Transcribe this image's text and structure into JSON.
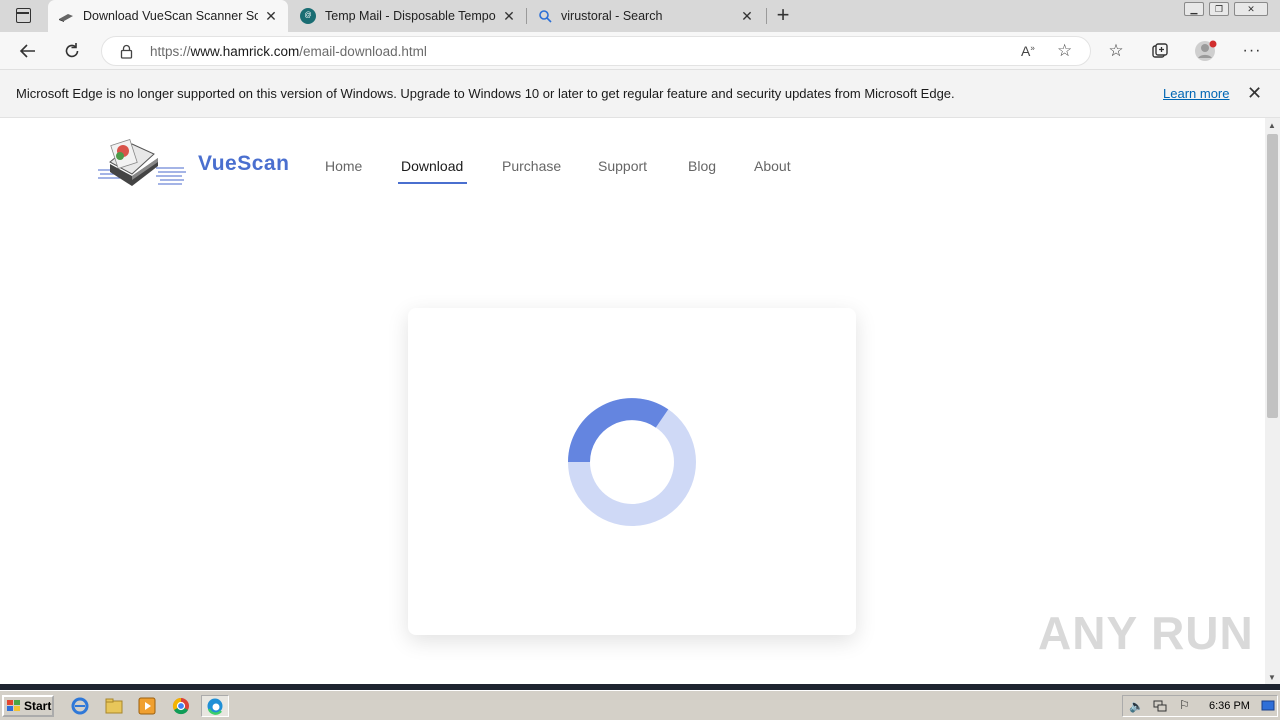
{
  "tabs": [
    {
      "title": "Download VueScan Scanner Software",
      "icon": "scanner-icon"
    },
    {
      "title": "Temp Mail - Disposable Temporary Email",
      "icon": "tempmail-icon"
    },
    {
      "title": "virustoral - Search",
      "icon": "search-icon"
    }
  ],
  "new_tab_label": "+",
  "address": {
    "prefix": "https://",
    "host": "www.hamrick.com",
    "path": "/email-download.html"
  },
  "infobar": {
    "message": "Microsoft Edge is no longer supported on this version of Windows. Upgrade to Windows 10 or later to get regular feature and security updates from Microsoft Edge.",
    "link": "Learn more"
  },
  "site": {
    "brand": "VueScan",
    "nav": [
      "Home",
      "Download",
      "Purchase",
      "Support",
      "Blog",
      "About"
    ],
    "active_nav": "Download",
    "accent": "#4a6fcf"
  },
  "watermark": "ANY RUN",
  "taskbar": {
    "start": "Start",
    "clock": "6:36 PM"
  }
}
